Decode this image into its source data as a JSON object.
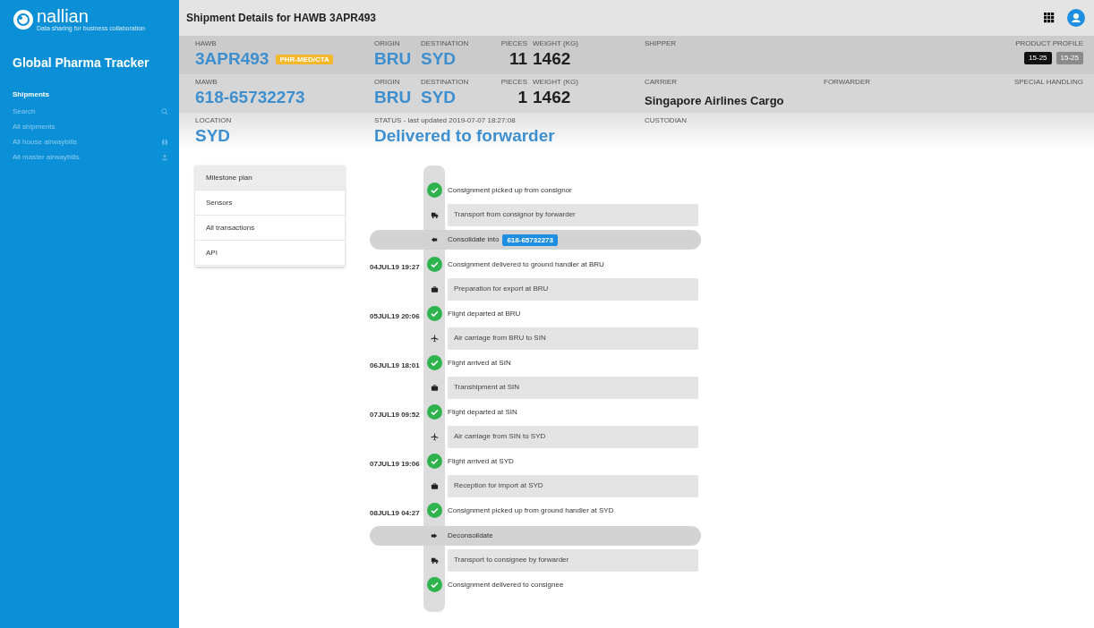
{
  "sidebar": {
    "logo": {
      "name": "nallian",
      "tagline": "Data sharing for business collaboration"
    },
    "app_title": "Global Pharma Tracker",
    "section": "Shipments",
    "items": [
      {
        "label": "Search",
        "kind": "search"
      },
      {
        "label": "All shipments",
        "kind": "plain"
      },
      {
        "label": "All house airwaybills",
        "kind": "house"
      },
      {
        "label": "All master airwaybills",
        "kind": "master"
      }
    ]
  },
  "header": {
    "title": "Shipment Details for HAWB 3APR493"
  },
  "rows": [
    {
      "kind": "identifiers",
      "fields": [
        {
          "label": "HAWB",
          "value": "3APR493",
          "kind": "code",
          "badge": "PHR-MED/CTA"
        },
        {
          "label": "ORIGIN",
          "value": "BRU",
          "kind": "code"
        },
        {
          "label": "DESTINATION",
          "value": "SYD",
          "kind": "code"
        },
        {
          "label": "PIECES",
          "value": "11",
          "kind": "number"
        },
        {
          "label": "WEIGHT (KG)",
          "value": "1462",
          "kind": "quantity"
        },
        {
          "label": "SHIPPER",
          "kind": "text"
        }
      ],
      "end": {
        "label": "PRODUCT PROFILE",
        "tags": [
          {
            "label": "15-25",
            "selected": true
          },
          {
            "label": "15-25",
            "selected": false
          }
        ]
      }
    },
    {
      "kind": "identifiers",
      "fields": [
        {
          "label": "MAWB",
          "value": "618-65732273",
          "kind": "code"
        },
        {
          "label": "ORIGIN",
          "value": "BRU",
          "kind": "code"
        },
        {
          "label": "DESTINATION",
          "value": "SYD",
          "kind": "code"
        },
        {
          "label": "PIECES",
          "value": "1",
          "kind": "number"
        },
        {
          "label": "WEIGHT (KG)",
          "value": "1462",
          "kind": "quantity"
        },
        {
          "label": "CARRIER",
          "value": "Singapore Airlines Cargo",
          "kind": "text"
        },
        {
          "label": "FORWARDER",
          "kind": "text"
        }
      ],
      "end": {
        "label": "SPECIAL HANDLING"
      }
    },
    {
      "kind": "status",
      "fields": [
        {
          "label": "LOCATION",
          "value": "SYD",
          "kind": "code"
        },
        {
          "label": "STATUS - last updated 2019-07-07 18:27:08",
          "value": "Delivered to forwarder",
          "kind": "code"
        },
        {
          "label": "CUSTODIAN",
          "kind": "text"
        }
      ]
    }
  ],
  "tabs": [
    {
      "label": "Milestone plan",
      "selected": true
    },
    {
      "label": "Sensors",
      "selected": false
    },
    {
      "label": "All transactions",
      "selected": false
    },
    {
      "label": "API",
      "selected": false
    }
  ],
  "timeline": [
    {
      "kind": "milestone",
      "text": "Consignment picked up from consignor",
      "done": true
    },
    {
      "kind": "transport",
      "text": "Transport from consignor by forwarder"
    },
    {
      "kind": "consolidate",
      "text": "Consolidate into",
      "tag": "618-65732273"
    },
    {
      "kind": "milestone",
      "date": "04JUL19 19:27",
      "text": "Consignment delivered to ground handler at BRU",
      "done": true
    },
    {
      "kind": "handling",
      "text": "Preparation for export at BRU"
    },
    {
      "kind": "milestone",
      "date": "05JUL19 20:06",
      "text": "Flight departed at BRU",
      "done": true
    },
    {
      "kind": "flight",
      "text": "Air carriage from BRU to SIN"
    },
    {
      "kind": "milestone",
      "date": "06JUL19 18:01",
      "text": "Flight arrived at SIN",
      "done": true
    },
    {
      "kind": "handling",
      "text": "Transhipment at SIN"
    },
    {
      "kind": "milestone",
      "date": "07JUL19 09:52",
      "text": "Flight departed at SIN",
      "done": true
    },
    {
      "kind": "flight",
      "text": "Air carriage from SIN to SYD"
    },
    {
      "kind": "milestone",
      "date": "07JUL19 19:06",
      "text": "Flight arrived at SYD",
      "done": true
    },
    {
      "kind": "handling",
      "text": "Reception for import at SYD"
    },
    {
      "kind": "milestone",
      "date": "08JUL19 04:27",
      "text": "Consignment picked up from ground handler at SYD",
      "done": true
    },
    {
      "kind": "deconsolidate",
      "text": "Deconsolidate"
    },
    {
      "kind": "transport",
      "text": "Transport to consignee by forwarder"
    },
    {
      "kind": "milestone",
      "text": "Consignment delivered to consignee",
      "done": true
    }
  ]
}
